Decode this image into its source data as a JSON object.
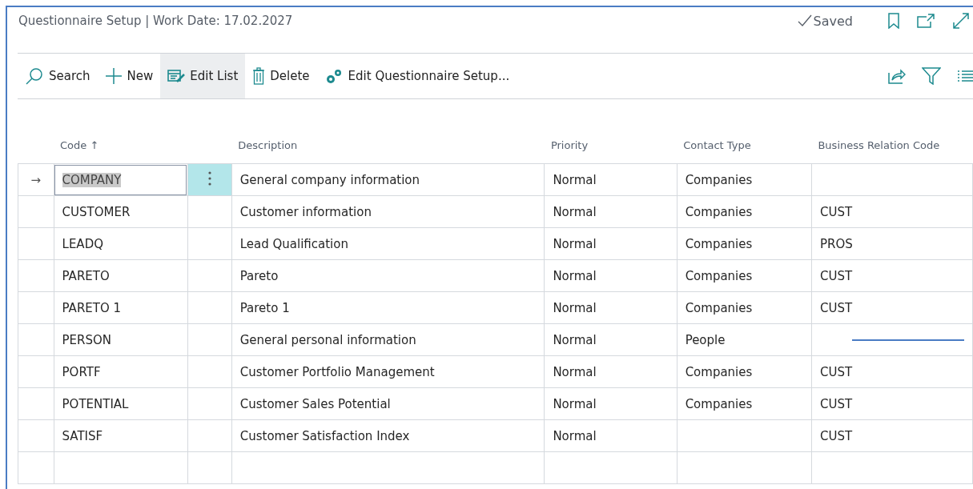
{
  "window": {
    "title": "Questionnaire Setup | Work Date: 17.02.2027",
    "status": "Saved"
  },
  "toolbar": [
    {
      "kind": "search",
      "label": "Search",
      "active": false
    },
    {
      "kind": "new",
      "label": "New",
      "active": false
    },
    {
      "kind": "edit-list",
      "label": "Edit List",
      "active": true
    },
    {
      "kind": "delete",
      "label": "Delete",
      "active": false
    },
    {
      "kind": "edit-setup",
      "label": "Edit Questionnaire Setup...",
      "active": false
    }
  ],
  "table": {
    "row_marker": "→",
    "columns": [
      {
        "label": "Code",
        "sort": "↑"
      },
      {
        "label": "Description"
      },
      {
        "label": "Priority"
      },
      {
        "label": "Contact Type"
      },
      {
        "label": "Business Relation Code"
      }
    ],
    "rows": [
      {
        "code": "COMPANY",
        "description": "General company information",
        "priority": "Normal",
        "contact_type": "Companies",
        "business_relation_code": "",
        "selected": true
      },
      {
        "code": "CUSTOMER",
        "description": "Customer information",
        "priority": "Normal",
        "contact_type": "Companies",
        "business_relation_code": "CUST",
        "selected": false
      },
      {
        "code": "LEADQ",
        "description": "Lead Qualification",
        "priority": "Normal",
        "contact_type": "Companies",
        "business_relation_code": "PROS",
        "selected": false
      },
      {
        "code": "PARETO",
        "description": "Pareto",
        "priority": "Normal",
        "contact_type": "Companies",
        "business_relation_code": "CUST",
        "selected": false
      },
      {
        "code": "PARETO 1",
        "description": "Pareto 1",
        "priority": "Normal",
        "contact_type": "Companies",
        "business_relation_code": "CUST",
        "selected": false
      },
      {
        "code": "PERSON",
        "description": "General personal information",
        "priority": "Normal",
        "contact_type": "People",
        "business_relation_code": "",
        "selected": false
      },
      {
        "code": "PORTF",
        "description": "Customer Portfolio Management",
        "priority": "Normal",
        "contact_type": "Companies",
        "business_relation_code": "CUST",
        "selected": false
      },
      {
        "code": "POTENTIAL",
        "description": "Customer Sales Potential",
        "priority": "Normal",
        "contact_type": "Companies",
        "business_relation_code": "CUST",
        "selected": false
      },
      {
        "code": "SATISF",
        "description": "Customer Satisfaction Index",
        "priority": "Normal",
        "contact_type": "",
        "business_relation_code": "CUST",
        "selected": false
      }
    ]
  }
}
